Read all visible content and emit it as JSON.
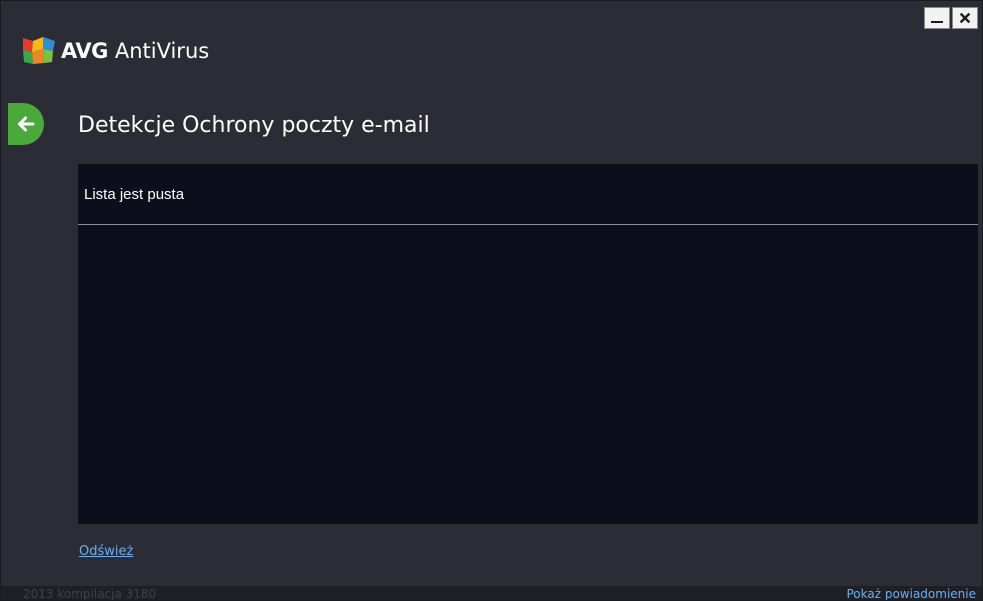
{
  "app": {
    "brand": "AVG",
    "product": "AntiVirus"
  },
  "window_controls": {
    "minimize_icon": "minimize-icon",
    "close_icon": "close-icon"
  },
  "page": {
    "title": "Detekcje Ochrony poczty e-mail",
    "back_icon": "arrow-left-icon"
  },
  "list": {
    "empty_message": "Lista jest pusta",
    "items": []
  },
  "actions": {
    "refresh_label": "Odśwież"
  },
  "footer": {
    "build_info": "2013  kompilacja 3180",
    "notification_link": "Pokaż powiadomienie"
  },
  "colors": {
    "window_bg": "#2b2c36",
    "panel_bg": "#0c0e1c",
    "back_button": "#4ba83a",
    "link": "#6ab0f0"
  }
}
